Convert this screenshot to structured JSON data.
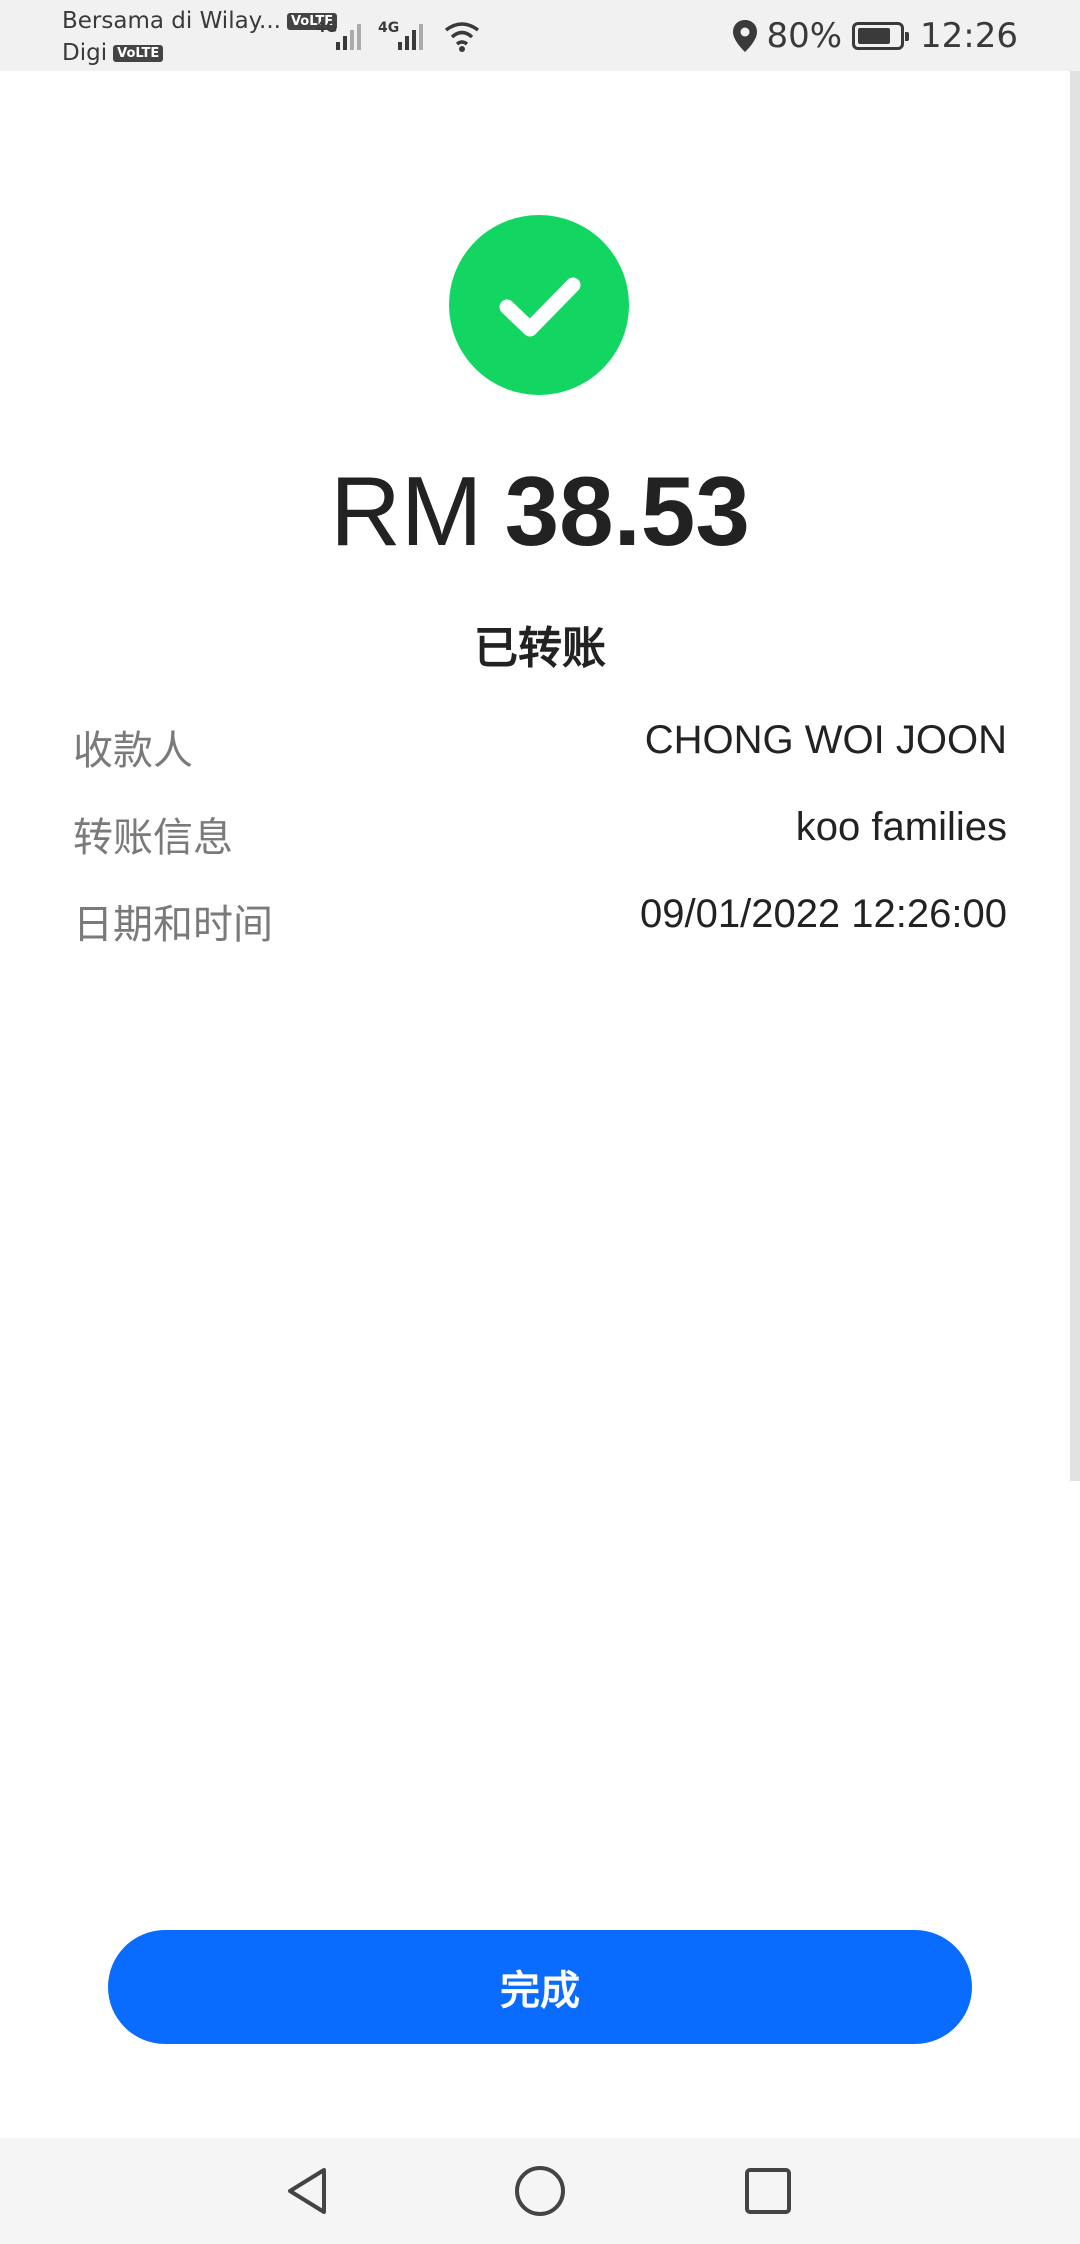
{
  "status_bar": {
    "carrier_1": "Bersama di Wilay...",
    "carrier_2": "Digi",
    "volte_badge": "VoLTE",
    "network_1": "4G",
    "network_2": "4G",
    "battery_percent": "80%",
    "battery_level": 0.8,
    "time": "12:26",
    "icons": [
      "location-icon",
      "battery-icon",
      "wifi-icon",
      "signal-icon"
    ]
  },
  "transfer": {
    "currency": "RM",
    "amount": "38.53",
    "status": "已转账",
    "details": [
      {
        "label": "收款人",
        "value": "CHONG WOI JOON"
      },
      {
        "label": "转账信息",
        "value": "koo families"
      },
      {
        "label": "日期和时间",
        "value": "09/01/2022 12:26:00"
      }
    ]
  },
  "actions": {
    "done_label": "完成"
  },
  "colors": {
    "success_green": "#12d661",
    "primary_blue": "#0a6cff",
    "text_dark": "#222222",
    "text_muted": "#7a7a7a"
  },
  "nav_bar": {
    "icons": [
      "back-icon",
      "home-icon",
      "recents-icon"
    ]
  }
}
